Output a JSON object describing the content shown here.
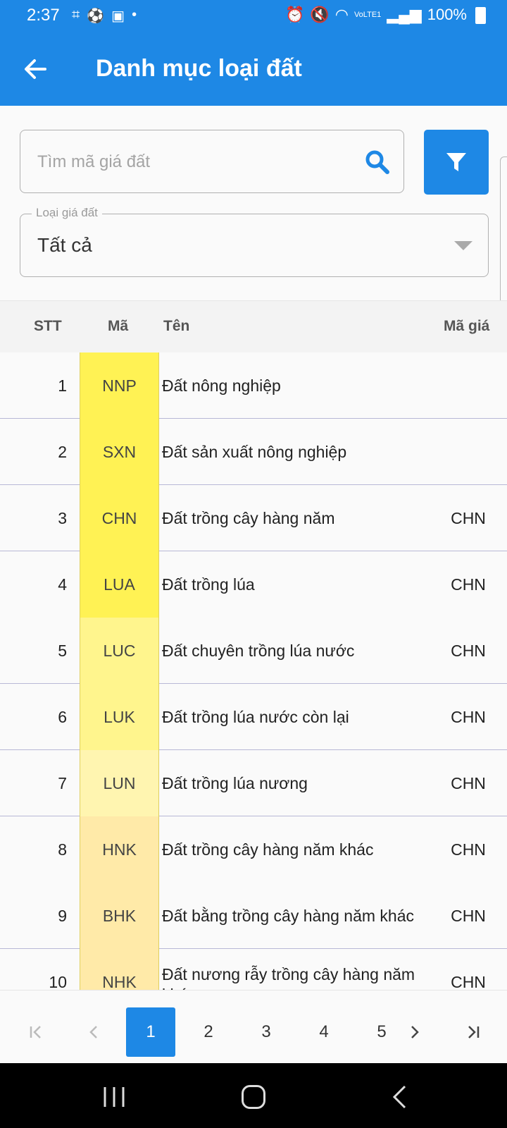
{
  "status_bar": {
    "time": "2:37",
    "battery_text": "100%",
    "network_text": "VoLTE1"
  },
  "header": {
    "title": "Danh mục loại đất",
    "background_color": "#1e88e5"
  },
  "search": {
    "placeholder": "Tìm mã giá đất",
    "value": ""
  },
  "filter_button": {
    "icon": "filter-icon"
  },
  "price_type_select": {
    "label": "Loại giá đất",
    "selected": "Tất cả"
  },
  "table": {
    "columns": {
      "stt": "STT",
      "ma": "Mã",
      "ten": "Tên",
      "ma_gia": "Mã giá"
    },
    "rows": [
      {
        "stt": "1",
        "ma": "NNP",
        "ten": "Đất nông nghiệp",
        "ma_gia": ""
      },
      {
        "stt": "2",
        "ma": "SXN",
        "ten": "Đất sản xuất nông nghiệp",
        "ma_gia": ""
      },
      {
        "stt": "3",
        "ma": "CHN",
        "ten": "Đất trồng cây hàng năm",
        "ma_gia": "CHN"
      },
      {
        "stt": "4",
        "ma": "LUA",
        "ten": "Đất trồng lúa",
        "ma_gia": "CHN"
      },
      {
        "stt": "5",
        "ma": "LUC",
        "ten": "Đất chuyên trồng lúa nước",
        "ma_gia": "CHN"
      },
      {
        "stt": "6",
        "ma": "LUK",
        "ten": "Đất trồng lúa nước còn lại",
        "ma_gia": "CHN"
      },
      {
        "stt": "7",
        "ma": "LUN",
        "ten": "Đất trồng lúa nương",
        "ma_gia": "CHN"
      },
      {
        "stt": "8",
        "ma": "HNK",
        "ten": "Đất trồng cây hàng năm khác",
        "ma_gia": "CHN"
      },
      {
        "stt": "9",
        "ma": "BHK",
        "ten": "Đất bằng trồng cây hàng năm khác",
        "ma_gia": "CHN"
      },
      {
        "stt": "10",
        "ma": "NHK",
        "ten": "Đất nương rẫy trồng cây hàng năm khác",
        "ma_gia": "CHN"
      }
    ],
    "ma_column_colors": [
      "#fff254",
      "#fff254",
      "#fff254",
      "#fff254",
      "#fff58d",
      "#fff58d",
      "#fff5b0",
      "#ffeaa8",
      "#ffeaa8",
      "#ffeaa8"
    ]
  },
  "pagination": {
    "pages": [
      "1",
      "2",
      "3",
      "4",
      "5"
    ],
    "current": "1"
  }
}
